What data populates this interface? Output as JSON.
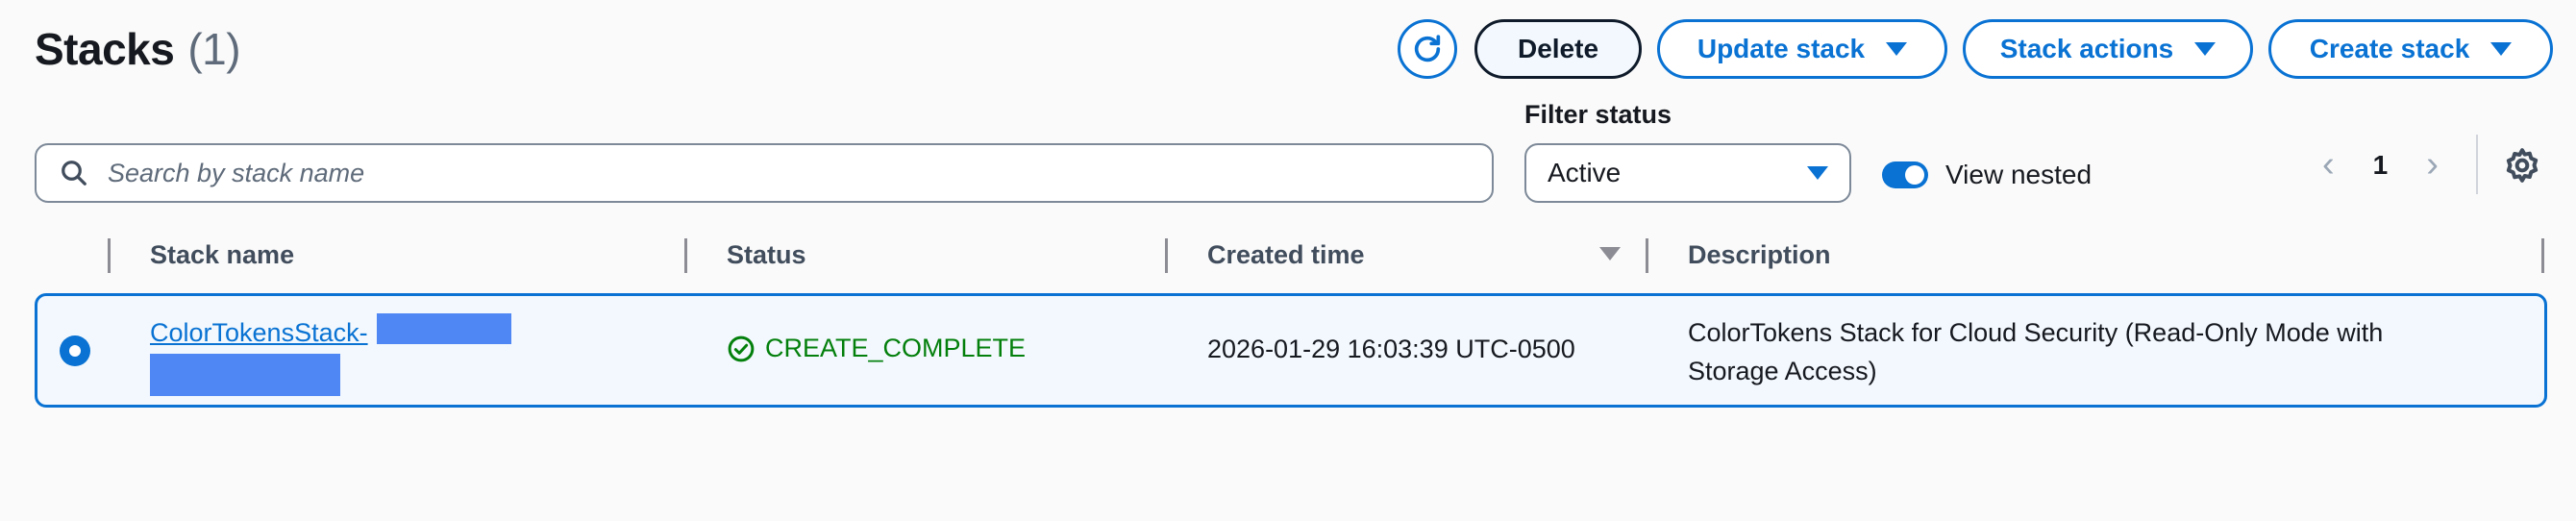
{
  "header": {
    "title": "Stacks",
    "count": "(1)"
  },
  "actions": {
    "delete_label": "Delete",
    "update_label": "Update stack",
    "stack_actions_label": "Stack actions",
    "create_label": "Create stack"
  },
  "search": {
    "placeholder": "Search by stack name",
    "value": ""
  },
  "filter": {
    "label": "Filter status",
    "selected": "Active"
  },
  "view_nested": {
    "label": "View nested",
    "enabled": true
  },
  "pagination": {
    "current_page": "1"
  },
  "table": {
    "headers": {
      "name": "Stack name",
      "status": "Status",
      "created": "Created time",
      "description": "Description"
    },
    "rows": [
      {
        "name": "ColorTokensStack-",
        "status": "CREATE_COMPLETE",
        "created": "2026-01-29 16:03:39 UTC-0500",
        "description": "ColorTokens Stack for Cloud Security (Read-Only Mode with Storage Access)",
        "selected": true
      }
    ]
  },
  "colors": {
    "accent": "#0972d3",
    "success": "#037f0c",
    "redaction": "#4f87f5"
  },
  "icons": [
    "refresh-icon",
    "caret-down-icon",
    "search-icon",
    "chevron-left-icon",
    "chevron-right-icon",
    "gear-icon",
    "status-success-icon"
  ]
}
